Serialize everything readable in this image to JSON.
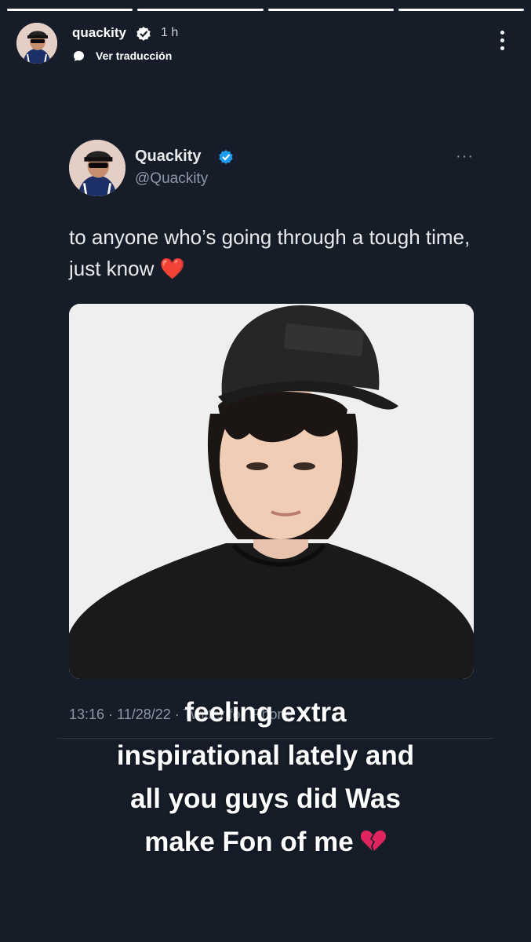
{
  "story": {
    "segments": 4,
    "username": "quackity",
    "time": "1 h",
    "translate_label": "Ver traducción"
  },
  "tweet": {
    "name": "Quackity",
    "handle": "@Quackity",
    "more": "···",
    "text": "to anyone who’s going through a tough time, just know",
    "heart_emoji": "❤️",
    "meta": "13:16 · 11/28/22 · Twitter for iPhone"
  },
  "caption": {
    "line1": "feeling extra",
    "line2": "inspirational lately and",
    "line3": "all you guys did Was",
    "line4": "make Fon of me",
    "emoji_icon": "broken-heart-icon"
  },
  "colors": {
    "background": "#161d29",
    "twitter_blue": "#1d9bf0",
    "muted": "#8b98a5"
  }
}
